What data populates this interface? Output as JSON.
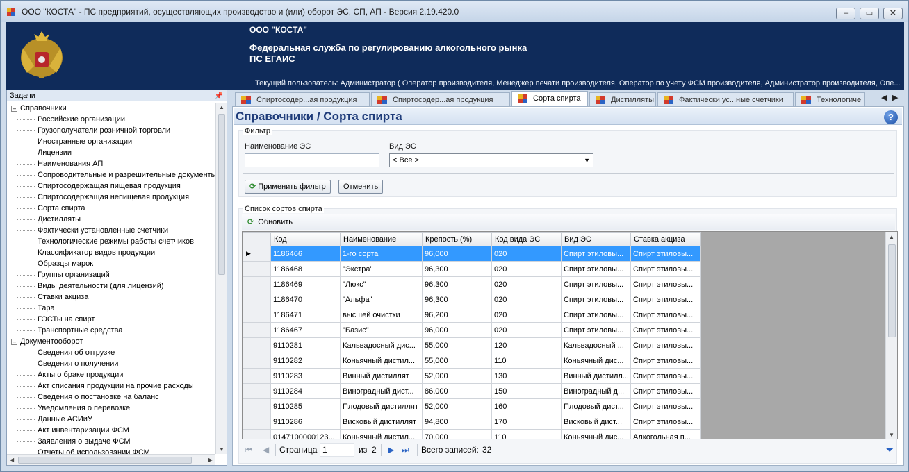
{
  "window": {
    "title": "ООО \"КОСТА\" - ПС предприятий, осуществляющих производство и (или) оборот ЭС, СП, АП - Версия 2.19.420.0",
    "minimize": "–",
    "maximize": "▭",
    "close": "✕"
  },
  "header": {
    "company": "ООО \"КОСТА\"",
    "agency": "Федеральная служба по регулированию алкогольного рынка",
    "system": "ПС ЕГАИС",
    "current_user": "Текущий пользователь: Администратор ( Оператор производителя, Менеджер печати производителя, Оператор по учету ФСМ производителя, Администратор производителя, Опе..."
  },
  "tasks": {
    "title": "Задачи",
    "groups": [
      {
        "label": "Справочники",
        "toggle": "–",
        "items": [
          "Российские организации",
          "Грузополучатели розничной торговли",
          "Иностранные организации",
          "Лицензии",
          "Наименования АП",
          "Сопроводительные и разрешительные документы",
          "Спиртосодержащая пищевая продукция",
          "Спиртосодержащая непищевая продукция",
          "Сорта спирта",
          "Дистилляты",
          "Фактически установленные счетчики",
          "Технологические режимы работы счетчиков",
          "Классификатор видов продукции",
          "Образцы марок",
          "Группы организаций",
          "Виды деятельности (для лицензий)",
          "Ставки акциза",
          "Тара",
          "ГОСТы на спирт",
          "Транспортные средства"
        ]
      },
      {
        "label": "Документооборот",
        "toggle": "–",
        "items": [
          "Сведения об отгрузке",
          "Сведения о получении",
          "Акты о браке продукции",
          "Акт списания продукции на прочие расходы",
          "Сведения о постановке на баланс",
          "Уведомления о перевозке",
          "Данные АСИиУ",
          "Акт инвентаризации ФСМ",
          "Заявления о выдаче ФСМ",
          "Отчеты об использовании ФСМ"
        ]
      }
    ]
  },
  "tabs": [
    {
      "label": "Спиртосодер...ая продукция",
      "active": false
    },
    {
      "label": "Спиртосодер...ая продукция",
      "active": false
    },
    {
      "label": "Сорта спирта",
      "active": true
    },
    {
      "label": "Дистилляты",
      "active": false
    },
    {
      "label": "Фактически ус...ные счетчики",
      "active": false
    },
    {
      "label": "Технологиче",
      "active": false
    }
  ],
  "tab_nav": {
    "prev": "◀",
    "next": "▶"
  },
  "page": {
    "title": "Справочники / Сорта спирта",
    "help": "?"
  },
  "filter": {
    "group_label": "Фильтр",
    "name_label": "Наименование ЭС",
    "name_value": "",
    "type_label": "Вид ЭС",
    "type_value": "< Все >",
    "apply_button": "Применить фильтр",
    "cancel_button": "Отменить"
  },
  "list": {
    "group_label": "Список сортов спирта",
    "refresh_button": "Обновить",
    "columns": [
      "Код",
      "Наименование",
      "Крепость (%)",
      "Код вида ЭС",
      "Вид ЭС",
      "Ставка акциза"
    ],
    "rows": [
      [
        "1186466",
        "1-го сорта",
        "96,000",
        "020",
        "Спирт этиловы...",
        "Спирт этиловы..."
      ],
      [
        "1186468",
        "\"Экстра\"",
        "96,300",
        "020",
        "Спирт этиловы...",
        "Спирт этиловы..."
      ],
      [
        "1186469",
        "\"Люкс\"",
        "96,300",
        "020",
        "Спирт этиловы...",
        "Спирт этиловы..."
      ],
      [
        "1186470",
        "\"Альфа\"",
        "96,300",
        "020",
        "Спирт этиловы...",
        "Спирт этиловы..."
      ],
      [
        "1186471",
        "высшей очистки",
        "96,200",
        "020",
        "Спирт этиловы...",
        "Спирт этиловы..."
      ],
      [
        "1186467",
        "\"Базис\"",
        "96,000",
        "020",
        "Спирт этиловы...",
        "Спирт этиловы..."
      ],
      [
        "9110281",
        "Кальвадосный дис...",
        "55,000",
        "120",
        "Кальвадосный ...",
        "Спирт этиловы..."
      ],
      [
        "9110282",
        "Коньячный дистил...",
        "55,000",
        "110",
        "Коньячный дис...",
        "Спирт этиловы..."
      ],
      [
        "9110283",
        "Винный дистиллят",
        "52,000",
        "130",
        "Винный дистилл...",
        "Спирт этиловы..."
      ],
      [
        "9110284",
        "Виноградный дист...",
        "86,000",
        "150",
        "Виноградный д...",
        "Спирт этиловы..."
      ],
      [
        "9110285",
        "Плодовый дистиллят",
        "52,000",
        "160",
        "Плодовый дист...",
        "Спирт этиловы..."
      ],
      [
        "9110286",
        "Висковый дистиллят",
        "94,800",
        "170",
        "Висковый дист...",
        "Спирт этиловы..."
      ],
      [
        "0147100000123...",
        "Коньячный дистил...",
        "70,000",
        "110",
        "Коньячный дис...",
        "Алкогольная п..."
      ]
    ],
    "selected_row": 0,
    "row_marker": "▶"
  },
  "pager": {
    "first": "⏮",
    "prev": "◀",
    "page_label": "Страница",
    "page_value": "1",
    "of_label": "из",
    "total_pages": "2",
    "next": "▶",
    "last": "⏭",
    "total_label": "Всего записей:",
    "total_records": "32"
  }
}
